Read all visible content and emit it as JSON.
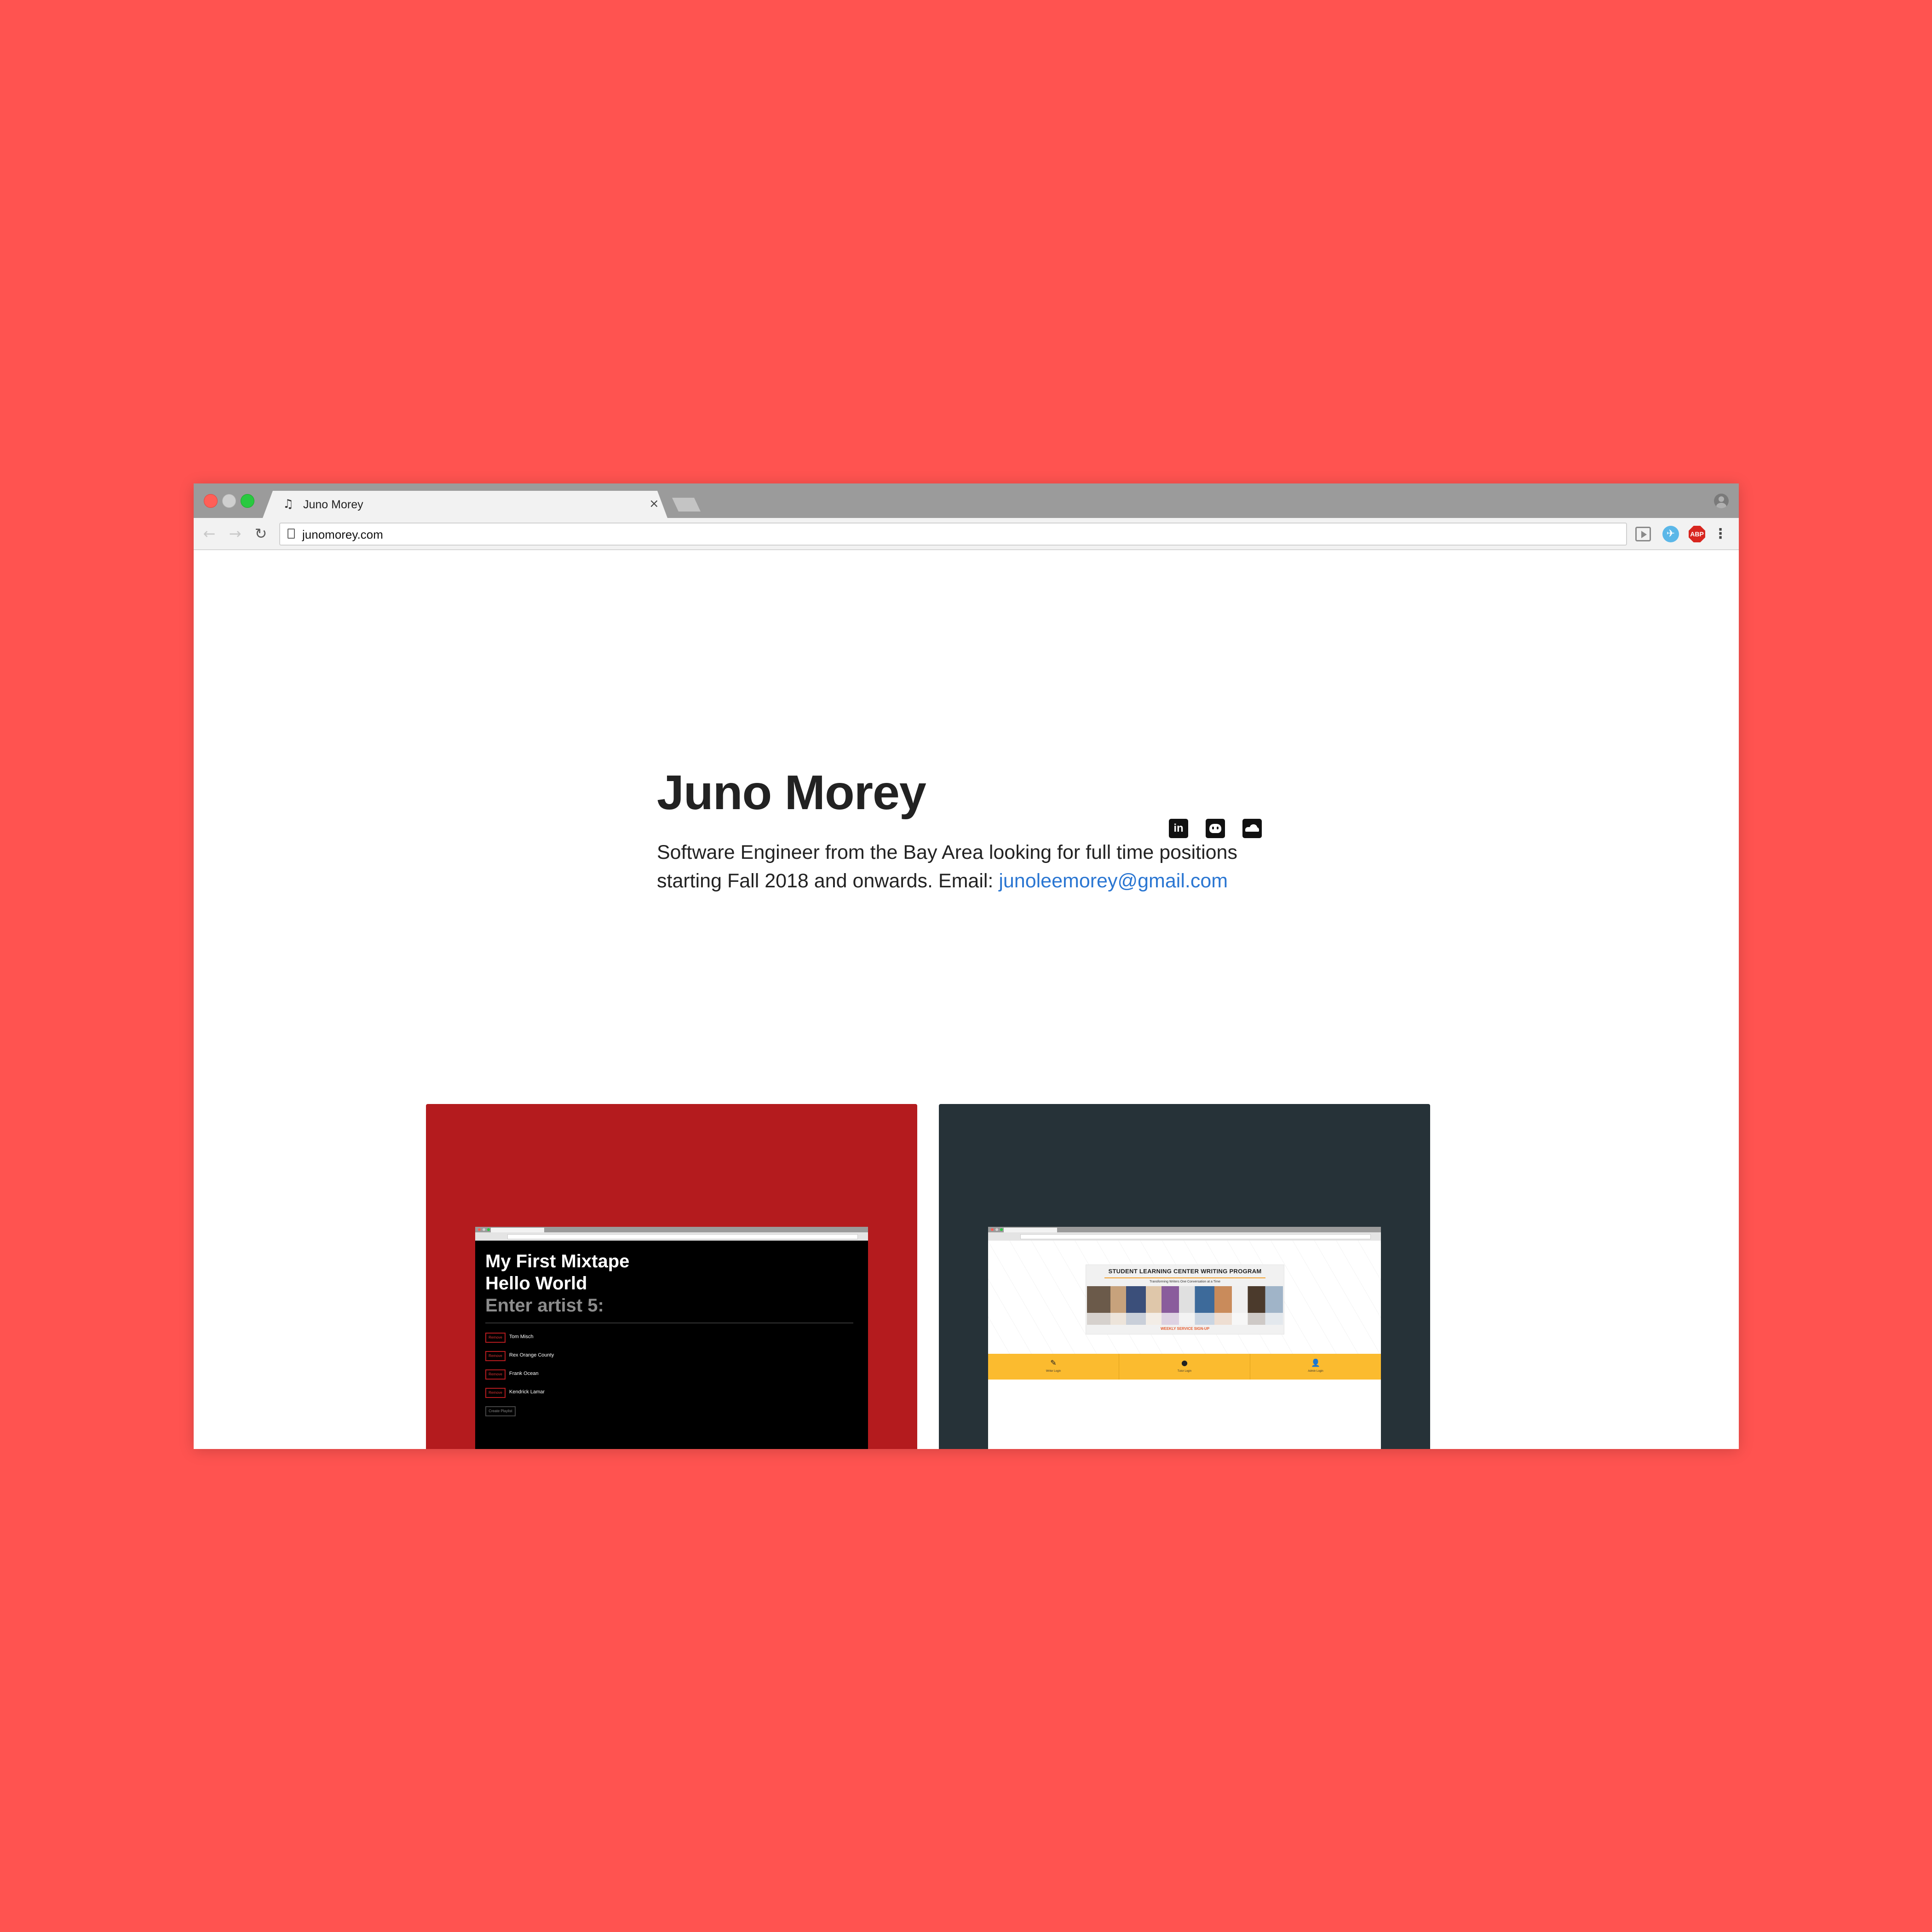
{
  "browser": {
    "tab_title": "Juno Morey",
    "tab_favicon": "♫",
    "tab_close": "×",
    "url": "junomorey.com",
    "nav": {
      "back": "←",
      "forward": "→",
      "reload": "↻"
    },
    "extensions": {
      "bird": "✈",
      "abp": "ABP",
      "menu": "⋮"
    }
  },
  "profile": {
    "name": "Juno Morey",
    "intro": "Software Engineer from the Bay Area looking for full time positions starting Fall 2018 and onwards. Email: ",
    "email": "junoleemorey@gmail.com",
    "social": {
      "linkedin_glyph": "in",
      "icons": [
        "linkedin-icon",
        "github-icon",
        "soundcloud-icon"
      ]
    }
  },
  "projects": [
    {
      "id": "mixtape",
      "card_color": "#b41b1e",
      "screenshot": {
        "line1": "My First Mixtape",
        "line2": "Hello World",
        "line3": "Enter artist 5:",
        "remove_label": "Remove",
        "artists": [
          "Tom Misch",
          "Rex Orange County",
          "Frank Ocean",
          "Kendrick Lamar"
        ],
        "save_label": "Create Playlist"
      }
    },
    {
      "id": "slc",
      "card_color": "#263238",
      "screenshot": {
        "banner_title": "STUDENT LEARNING CENTER WRITING PROGRAM",
        "banner_subtitle": "Transforming Writers One Conversation at a Time",
        "banner_cta": "WEEKLY SERVICE SIGN-UP",
        "nav": [
          {
            "icon": "✎",
            "label": "Writer Login"
          },
          {
            "icon": "●",
            "label": "Tutor Login"
          },
          {
            "icon": "👤",
            "label": "Admin Login"
          }
        ]
      }
    }
  ],
  "colors": {
    "background": "#ff5350",
    "link": "#2a76d2",
    "slc_nav": "#fbbb2f"
  }
}
